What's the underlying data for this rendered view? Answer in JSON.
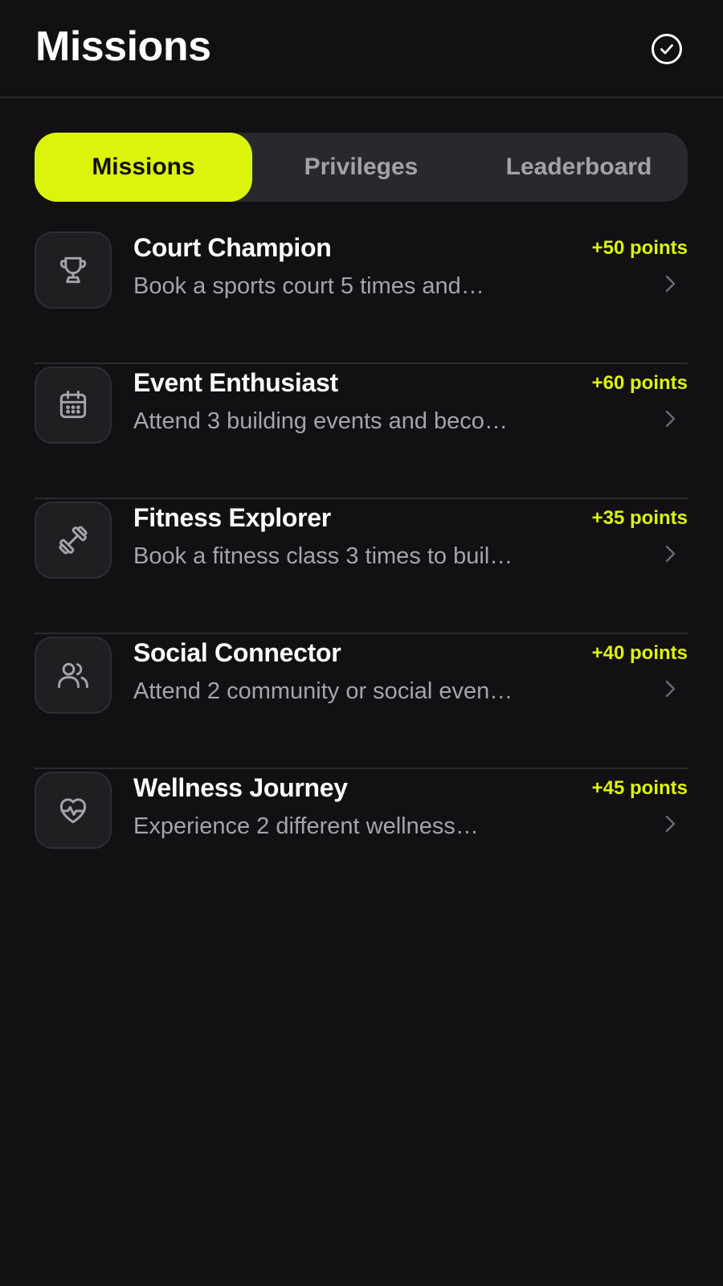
{
  "header": {
    "title": "Missions",
    "action_icon": "check-circle-icon"
  },
  "tabs": [
    {
      "label": "Missions",
      "active": true
    },
    {
      "label": "Privileges",
      "active": false
    },
    {
      "label": "Leaderboard",
      "active": false
    }
  ],
  "missions": [
    {
      "icon": "trophy-icon",
      "title": "Court Champion",
      "description": "Book a sports court 5 times and…",
      "points": "+50 points"
    },
    {
      "icon": "calendar-icon",
      "title": "Event Enthusiast",
      "description": "Attend 3 building events and beco…",
      "points": "+60 points"
    },
    {
      "icon": "dumbbell-icon",
      "title": "Fitness Explorer",
      "description": "Book a fitness class 3 times to buil…",
      "points": "+35 points"
    },
    {
      "icon": "users-icon",
      "title": "Social Connector",
      "description": "Attend 2 community or social even…",
      "points": "+40 points"
    },
    {
      "icon": "heart-pulse-icon",
      "title": "Wellness Journey",
      "description": "Experience 2 different wellness…",
      "points": "+45 points"
    }
  ],
  "colors": {
    "accent": "#dcf40c",
    "background": "#121013",
    "muted_text": "#a6a4a8"
  }
}
